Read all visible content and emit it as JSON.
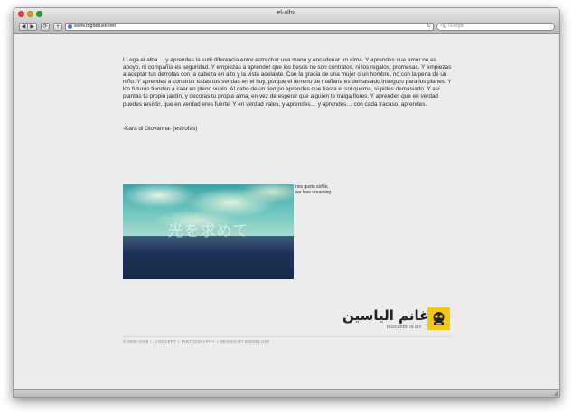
{
  "window": {
    "title": "el-alba"
  },
  "toolbar": {
    "back_icon": "◀",
    "forward_icon": "▶",
    "reload_icon": "⟳",
    "add_icon": "+",
    "url": "www.bigdeluxe.net",
    "url_reload_icon": "↻",
    "search_icon": "🔍",
    "search_placeholder": "Google"
  },
  "article": {
    "body": "LLega el alba ... y aprendes la sutil diferencia entre estrechar una mano y encadenar un alma. Y aprendes que amor no es apoyo, ni compañía es seguridad. Y empiezas a aprender que los besos no son contratos, ni los regalos, promesas. Y empiezas a aceptar tus derrotas con la cabeza en alto y la vista adelante. Con la gracia de una mujer o un hombre, no con la pena de un niño. Y aprendes a construir todas tus sendas en el hoy, porque el terreno de mañana es demasiado inseguro para los planes. Y los futuros tienden a caer en pleno vuelo. Al cabo de un tiempo aprendes que hasta el sol quema, si pides demasiado. Y así plantas tu propio jardín, y decoras tu propia alma, en vez de esperar que alguien te traiga flores. Y aprendes que en verdad puedes resistir, que en verdad eres fuerte. Y en verdad vales, y aprendes… y aprendes… con cada fracaso, aprendes.",
    "author": "-Kara di Giovanna- (estrofas)"
  },
  "photo": {
    "overlay_text": "光を求めて"
  },
  "caption": {
    "line1": "nos gusta soñar,",
    "line2": "we love dreaming."
  },
  "logo": {
    "arabic": "غانم الياسين",
    "subtitle": "buscando la luz"
  },
  "footer": {
    "text": "© 2006-2008 ::: CONCEPT + PHOTOGRAPHY + DESIGN BY BIGDELUXE"
  },
  "colors": {
    "logo_yellow": "#f3c712",
    "sky": "#6cc4bf",
    "sea": "#1e3358"
  }
}
